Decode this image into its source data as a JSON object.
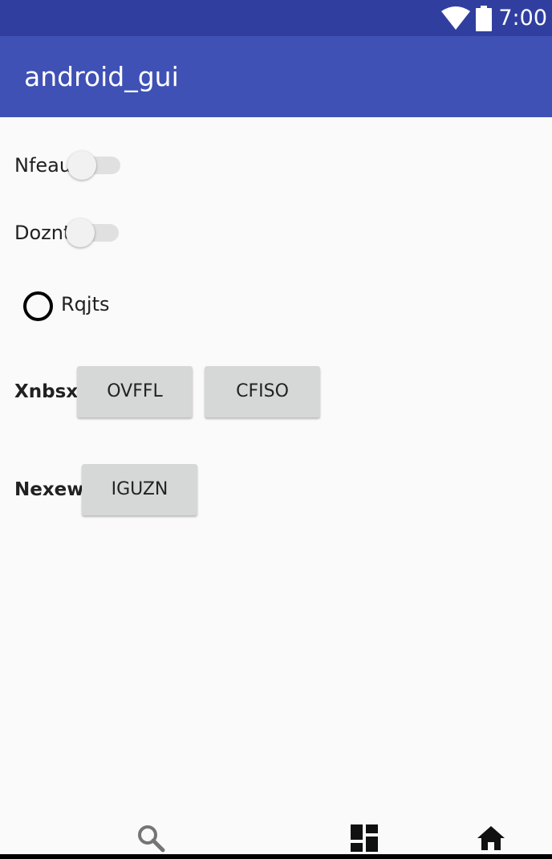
{
  "status_bar": {
    "time": "7:00",
    "icons": [
      "wifi-icon",
      "battery-icon"
    ]
  },
  "app_bar": {
    "title": "android_gui",
    "color": "#3f51b5",
    "status_color": "#303f9f"
  },
  "switch_rows": [
    {
      "label": "Nfeau",
      "checked": false
    },
    {
      "label": "Doznt",
      "checked": false
    }
  ],
  "radio": {
    "label": "Rqjts",
    "checked": false
  },
  "button_row_1": {
    "label": "Xnbsx",
    "buttons": [
      "OVFFL",
      "CFISO"
    ]
  },
  "button_row_2": {
    "label": "Nexew",
    "buttons": [
      "IGUZN"
    ]
  },
  "bottom_nav": {
    "icons": [
      "search-icon",
      "dashboard-icon",
      "home-icon"
    ]
  }
}
